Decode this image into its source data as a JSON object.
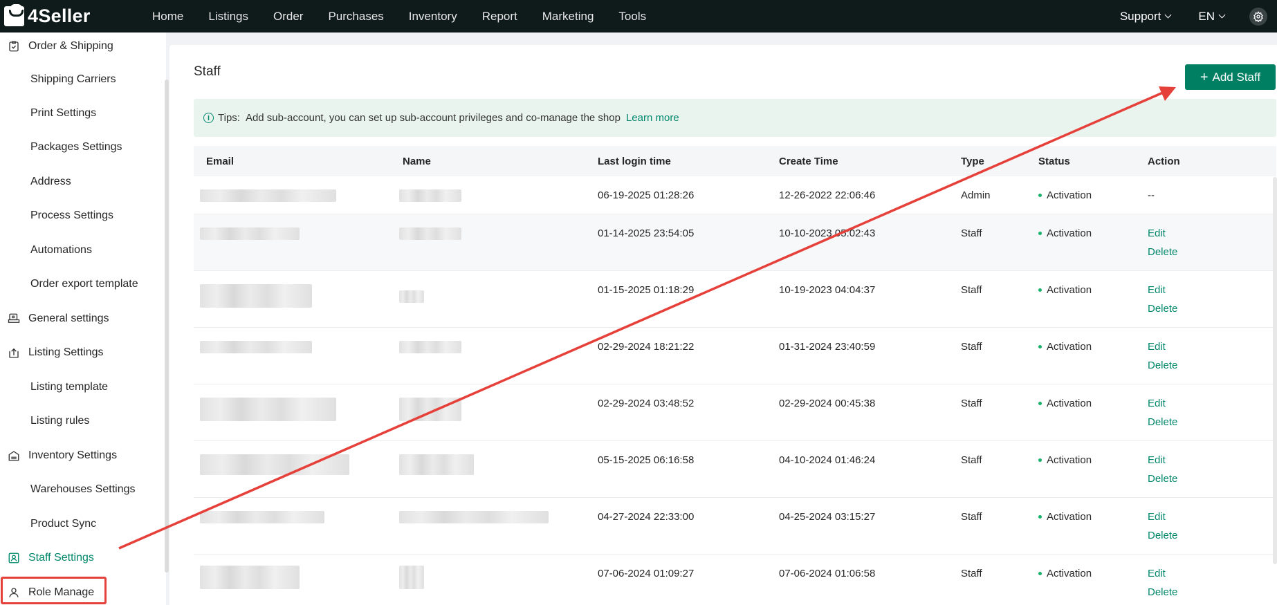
{
  "app": {
    "brand": "4Seller",
    "nav": [
      "Home",
      "Listings",
      "Order",
      "Purchases",
      "Inventory",
      "Report",
      "Marketing",
      "Tools"
    ],
    "support_label": "Support",
    "language": "EN"
  },
  "sidebar": {
    "items": [
      {
        "label": "Order & Shipping",
        "kind": "group",
        "icon": "clipboard-icon"
      },
      {
        "label": "Shipping Carriers",
        "kind": "sub"
      },
      {
        "label": "Print Settings",
        "kind": "sub"
      },
      {
        "label": "Packages Settings",
        "kind": "sub"
      },
      {
        "label": "Address",
        "kind": "sub"
      },
      {
        "label": "Process Settings",
        "kind": "sub"
      },
      {
        "label": "Automations",
        "kind": "sub"
      },
      {
        "label": "Order export template",
        "kind": "sub"
      },
      {
        "label": "General settings",
        "kind": "group",
        "icon": "printer-icon"
      },
      {
        "label": "Listing Settings",
        "kind": "group",
        "icon": "upload-box-icon"
      },
      {
        "label": "Listing template",
        "kind": "sub"
      },
      {
        "label": "Listing rules",
        "kind": "sub"
      },
      {
        "label": "Inventory Settings",
        "kind": "group",
        "icon": "warehouse-icon"
      },
      {
        "label": "Warehouses Settings",
        "kind": "sub"
      },
      {
        "label": "Product Sync",
        "kind": "sub"
      },
      {
        "label": "Staff Settings",
        "kind": "group",
        "icon": "staff-badge-icon",
        "active": true
      },
      {
        "label": "Role Manage",
        "kind": "group",
        "icon": "user-icon"
      }
    ]
  },
  "page": {
    "title": "Staff",
    "add_button": "Add Staff",
    "tips_label": "Tips:",
    "tips_text": "Add sub-account, you can set up sub-account privileges and co-manage the shop",
    "learn_more": "Learn more"
  },
  "table": {
    "headers": [
      "Email",
      "Name",
      "Last login time",
      "Create Time",
      "Type",
      "Status",
      "Action"
    ],
    "rows": [
      {
        "last_login": "06-19-2025 01:28:26",
        "create_time": "12-26-2022 22:06:46",
        "type": "Admin",
        "status": "Activation",
        "action": "--"
      },
      {
        "last_login": "01-14-2025 23:54:05",
        "create_time": "10-10-2023 05:02:43",
        "type": "Staff",
        "status": "Activation",
        "edit": "Edit",
        "delete": "Delete"
      },
      {
        "last_login": "01-15-2025 01:18:29",
        "create_time": "10-19-2023 04:04:37",
        "type": "Staff",
        "status": "Activation",
        "edit": "Edit",
        "delete": "Delete"
      },
      {
        "last_login": "02-29-2024 18:21:22",
        "create_time": "01-31-2024 23:40:59",
        "type": "Staff",
        "status": "Activation",
        "edit": "Edit",
        "delete": "Delete"
      },
      {
        "last_login": "02-29-2024 03:48:52",
        "create_time": "02-29-2024 00:45:38",
        "type": "Staff",
        "status": "Activation",
        "edit": "Edit",
        "delete": "Delete"
      },
      {
        "last_login": "05-15-2025 06:16:58",
        "create_time": "04-10-2024 01:46:24",
        "type": "Staff",
        "status": "Activation",
        "edit": "Edit",
        "delete": "Delete"
      },
      {
        "last_login": "04-27-2024 22:33:00",
        "create_time": "04-25-2024 03:15:27",
        "type": "Staff",
        "status": "Activation",
        "edit": "Edit",
        "delete": "Delete"
      },
      {
        "last_login": "07-06-2024 01:09:27",
        "create_time": "07-06-2024 01:06:58",
        "type": "Staff",
        "status": "Activation",
        "edit": "Edit",
        "delete": "Delete"
      }
    ]
  },
  "colors": {
    "topbar": "#0f1a1a",
    "accent": "#007f63",
    "annotation": "#e5403a",
    "status_dot": "#17b26a"
  }
}
